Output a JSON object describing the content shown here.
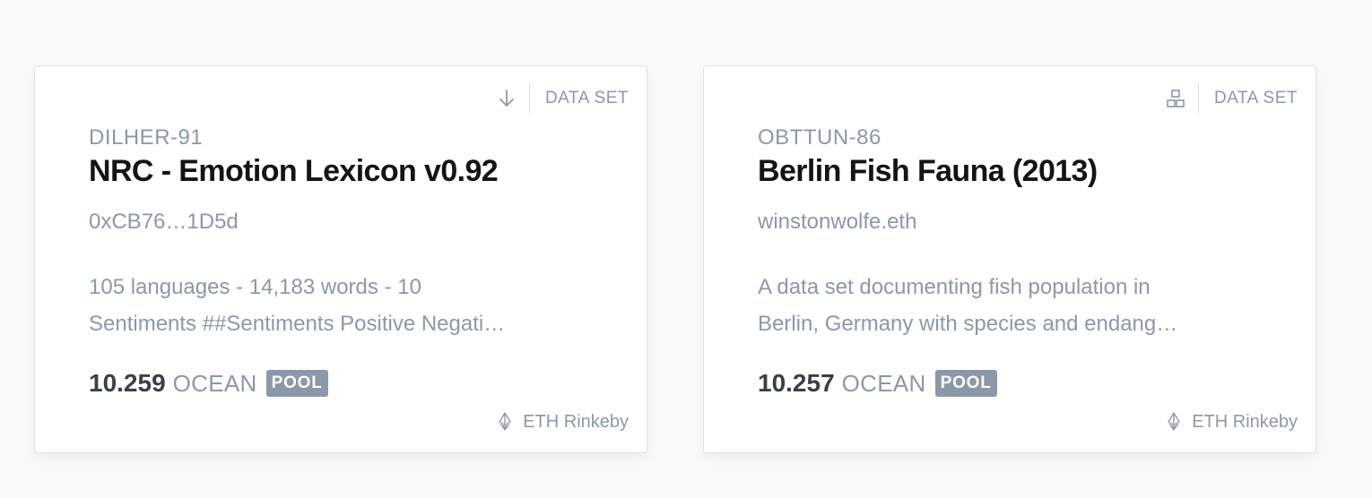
{
  "colors": {
    "accent_arc": "#e45da0",
    "muted_text": "#8b98a9",
    "title_text": "#141414",
    "badge_bg": "#8b98a9"
  },
  "assets": [
    {
      "type_icon": "download-arrow-icon",
      "type_label": "DATA SET",
      "symbol": "DILHER-91",
      "title": "NRC - Emotion Lexicon v0.92",
      "owner": "0xCB76…1D5d",
      "description_lines": [
        "105 languages - 14,183 words - 10",
        "Sentiments ##Sentiments Positive Negati…"
      ],
      "price_value": "10.259",
      "price_token": "OCEAN",
      "price_badge": "POOL",
      "network_icon": "ethereum-icon",
      "network": "ETH Rinkeby"
    },
    {
      "type_icon": "compute-nodes-icon",
      "type_label": "DATA SET",
      "symbol": "OBTTUN-86",
      "title": "Berlin Fish Fauna (2013)",
      "owner": "winstonwolfe.eth",
      "description_lines": [
        "A data set documenting fish population in",
        "Berlin, Germany with species and endang…"
      ],
      "price_value": "10.257",
      "price_token": "OCEAN",
      "price_badge": "POOL",
      "network_icon": "ethereum-icon",
      "network": "ETH Rinkeby"
    }
  ]
}
